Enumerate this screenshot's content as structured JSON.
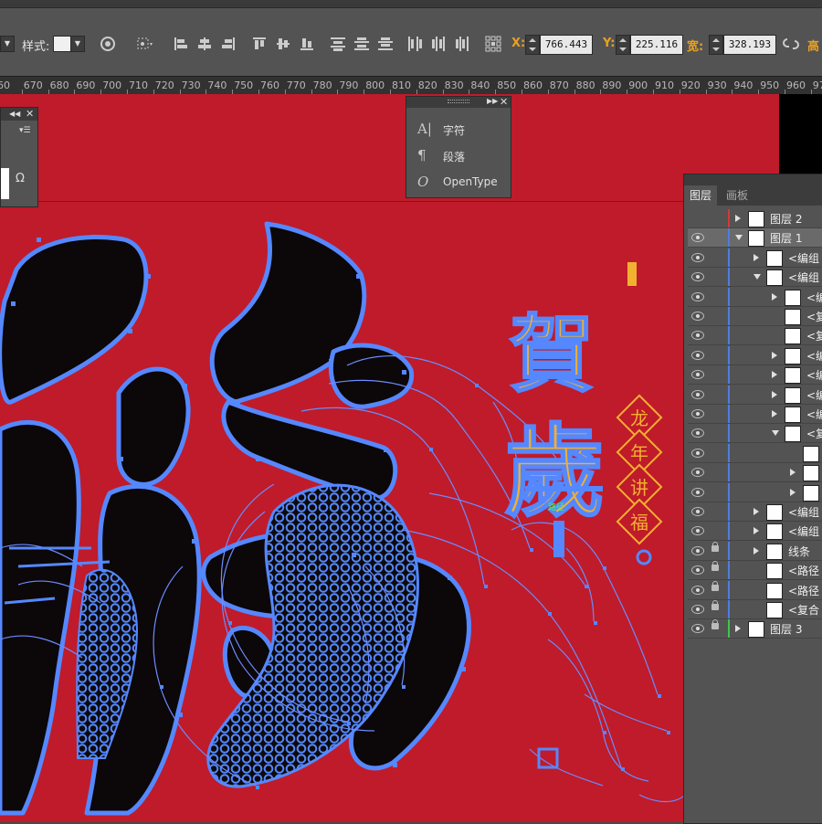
{
  "toolbar": {
    "style_label": "样式:",
    "x_label": "X:",
    "x_value": "766.443",
    "y_label": "Y:",
    "y_value": "225.116",
    "w_label": "宽:",
    "w_value": "328.193",
    "h_label": "高"
  },
  "ruler": {
    "ticks": [
      "60",
      "670",
      "680",
      "690",
      "700",
      "710",
      "720",
      "730",
      "740",
      "750",
      "760",
      "770",
      "780",
      "790",
      "800",
      "810",
      "820",
      "830",
      "840",
      "850",
      "860",
      "870",
      "880",
      "890",
      "900",
      "910",
      "920",
      "930",
      "940",
      "950",
      "960",
      "970"
    ]
  },
  "char_panel": {
    "items": [
      {
        "icon": "character-icon",
        "label": "字符"
      },
      {
        "icon": "paragraph-icon",
        "label": "段落"
      },
      {
        "icon": "opentype-icon",
        "label": "OpenType"
      }
    ]
  },
  "artwork": {
    "title_glyphs": [
      "賀",
      "歲"
    ],
    "badge_glyphs": [
      "龙",
      "年",
      "讲",
      "福"
    ],
    "path_label": "路径"
  },
  "layers_panel": {
    "tabs": [
      "图层",
      "画板"
    ],
    "active_tab": "图层",
    "rows": [
      {
        "name": "图层 2",
        "indent": 0,
        "expander": "right",
        "eye": false,
        "lock": false,
        "color": "#d23a3a"
      },
      {
        "name": "图层 1",
        "indent": 0,
        "expander": "down",
        "eye": true,
        "lock": false,
        "color": "#4f7de0",
        "selected": true
      },
      {
        "name": "<编组",
        "indent": 1,
        "expander": "right",
        "eye": true,
        "lock": false,
        "color": "#4f7de0"
      },
      {
        "name": "<编组",
        "indent": 1,
        "expander": "down",
        "eye": true,
        "lock": false,
        "color": "#4f7de0"
      },
      {
        "name": "<编",
        "indent": 2,
        "expander": "right",
        "eye": true,
        "lock": false,
        "color": "#4f7de0"
      },
      {
        "name": "<复",
        "indent": 2,
        "expander": "",
        "eye": true,
        "lock": false,
        "color": "#4f7de0"
      },
      {
        "name": "<复",
        "indent": 2,
        "expander": "",
        "eye": true,
        "lock": false,
        "color": "#4f7de0"
      },
      {
        "name": "<编",
        "indent": 2,
        "expander": "right",
        "eye": true,
        "lock": false,
        "color": "#4f7de0"
      },
      {
        "name": "<编",
        "indent": 2,
        "expander": "right",
        "eye": true,
        "lock": false,
        "color": "#4f7de0"
      },
      {
        "name": "<编",
        "indent": 2,
        "expander": "right",
        "eye": true,
        "lock": false,
        "color": "#4f7de0"
      },
      {
        "name": "<编",
        "indent": 2,
        "expander": "right",
        "eye": true,
        "lock": false,
        "color": "#4f7de0"
      },
      {
        "name": "<复",
        "indent": 2,
        "expander": "down",
        "eye": true,
        "lock": false,
        "color": "#4f7de0"
      },
      {
        "name": "",
        "indent": 3,
        "expander": "",
        "eye": true,
        "lock": false,
        "color": "#4f7de0"
      },
      {
        "name": "",
        "indent": 3,
        "expander": "right",
        "eye": true,
        "lock": false,
        "color": "#4f7de0"
      },
      {
        "name": "",
        "indent": 3,
        "expander": "right",
        "eye": true,
        "lock": false,
        "color": "#4f7de0"
      },
      {
        "name": "<编组",
        "indent": 1,
        "expander": "right",
        "eye": true,
        "lock": false,
        "color": "#4f7de0"
      },
      {
        "name": "<编组",
        "indent": 1,
        "expander": "right",
        "eye": true,
        "lock": false,
        "color": "#4f7de0"
      },
      {
        "name": "线条",
        "indent": 1,
        "expander": "right",
        "eye": true,
        "lock": true,
        "color": "#4f7de0"
      },
      {
        "name": "<路径",
        "indent": 1,
        "expander": "",
        "eye": true,
        "lock": true,
        "color": "#4f7de0"
      },
      {
        "name": "<路径",
        "indent": 1,
        "expander": "",
        "eye": true,
        "lock": true,
        "color": "#4f7de0"
      },
      {
        "name": "<复合",
        "indent": 1,
        "expander": "",
        "eye": true,
        "lock": true,
        "color": "#4f7de0"
      },
      {
        "name": "图层 3",
        "indent": 0,
        "expander": "right",
        "eye": true,
        "lock": true,
        "color": "#3cc84a"
      }
    ]
  },
  "colors": {
    "artboard": "#bf1b2a",
    "path_blue": "#5588ff",
    "accent_gold": "#f2b030"
  }
}
